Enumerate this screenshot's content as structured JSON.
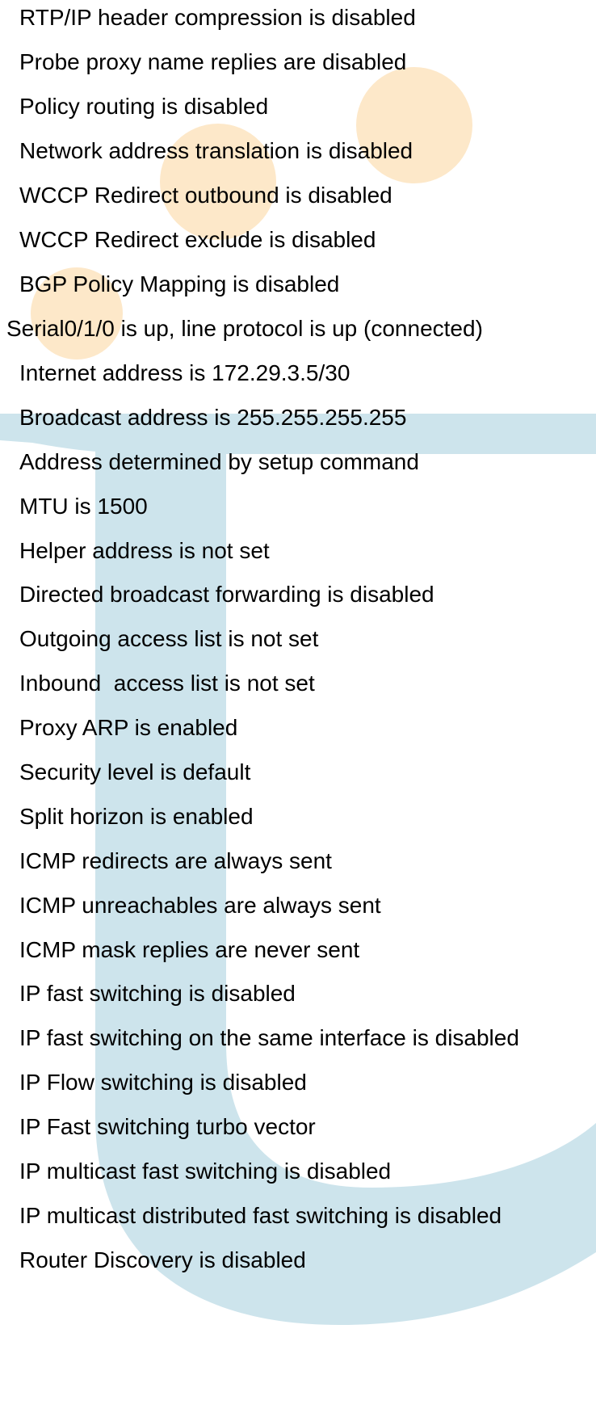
{
  "colors": {
    "background": "#ffffff",
    "text": "#000000",
    "watermark_blue": "#cde4ec",
    "watermark_orange": "#fde8c9"
  },
  "lines": [
    "RTP/IP header compression is disabled",
    "Probe proxy name replies are disabled",
    "Policy routing is disabled",
    "Network address translation is disabled",
    "WCCP Redirect outbound is disabled",
    "WCCP Redirect exclude is disabled",
    "BGP Policy Mapping is disabled",
    "Serial0/1/0 is up, line protocol is up (connected)",
    "Internet address is 172.29.3.5/30",
    "Broadcast address is 255.255.255.255",
    "Address determined by setup command",
    "MTU is 1500",
    "Helper address is not set",
    "Directed broadcast forwarding is disabled",
    "Outgoing access list is not set",
    "Inbound  access list is not set",
    "Proxy ARP is enabled",
    "Security level is default",
    "Split horizon is enabled",
    "ICMP redirects are always sent",
    "ICMP unreachables are always sent",
    "ICMP mask replies are never sent",
    "IP fast switching is disabled",
    "IP fast switching on the same interface is disabled",
    "IP Flow switching is disabled",
    "IP Fast switching turbo vector",
    "IP multicast fast switching is disabled",
    "IP multicast distributed fast switching is disabled",
    "Router Discovery is disabled"
  ]
}
